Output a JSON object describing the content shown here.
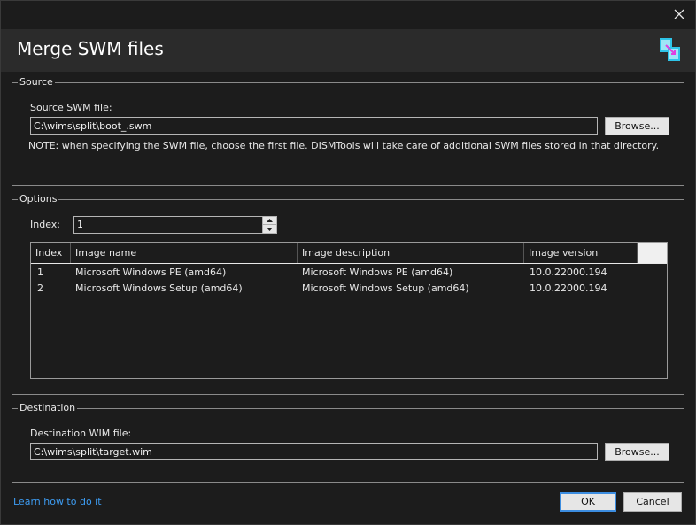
{
  "dialog": {
    "title": "Merge SWM files",
    "icon": "dismtools-merge-icon",
    "close_icon": "close-icon"
  },
  "source": {
    "group_label": "Source",
    "field_label": "Source SWM file:",
    "field_value": "C:\\wims\\split\\boot_.swm",
    "browse_label": "Browse...",
    "note": "NOTE: when specifying the SWM file, choose the first file. DISMTools will take care of additional SWM files stored in that directory."
  },
  "options": {
    "group_label": "Options",
    "index_label": "Index:",
    "index_value": "1",
    "columns": [
      "Index",
      "Image name",
      "Image description",
      "Image version"
    ],
    "rows": [
      [
        "1",
        "Microsoft Windows PE (amd64)",
        "Microsoft Windows PE (amd64)",
        "10.0.22000.194"
      ],
      [
        "2",
        "Microsoft Windows Setup (amd64)",
        "Microsoft Windows Setup (amd64)",
        "10.0.22000.194"
      ]
    ]
  },
  "destination": {
    "group_label": "Destination",
    "field_label": "Destination WIM file:",
    "field_value": "C:\\wims\\split\\target.wim",
    "browse_label": "Browse..."
  },
  "footer": {
    "help_link": "Learn how to do it",
    "ok_label": "OK",
    "cancel_label": "Cancel"
  },
  "colors": {
    "window_bg": "#1c1c1c",
    "header_bg": "#2b2b2b",
    "link": "#3d9bf0",
    "default_button_border": "#3c8de0"
  }
}
